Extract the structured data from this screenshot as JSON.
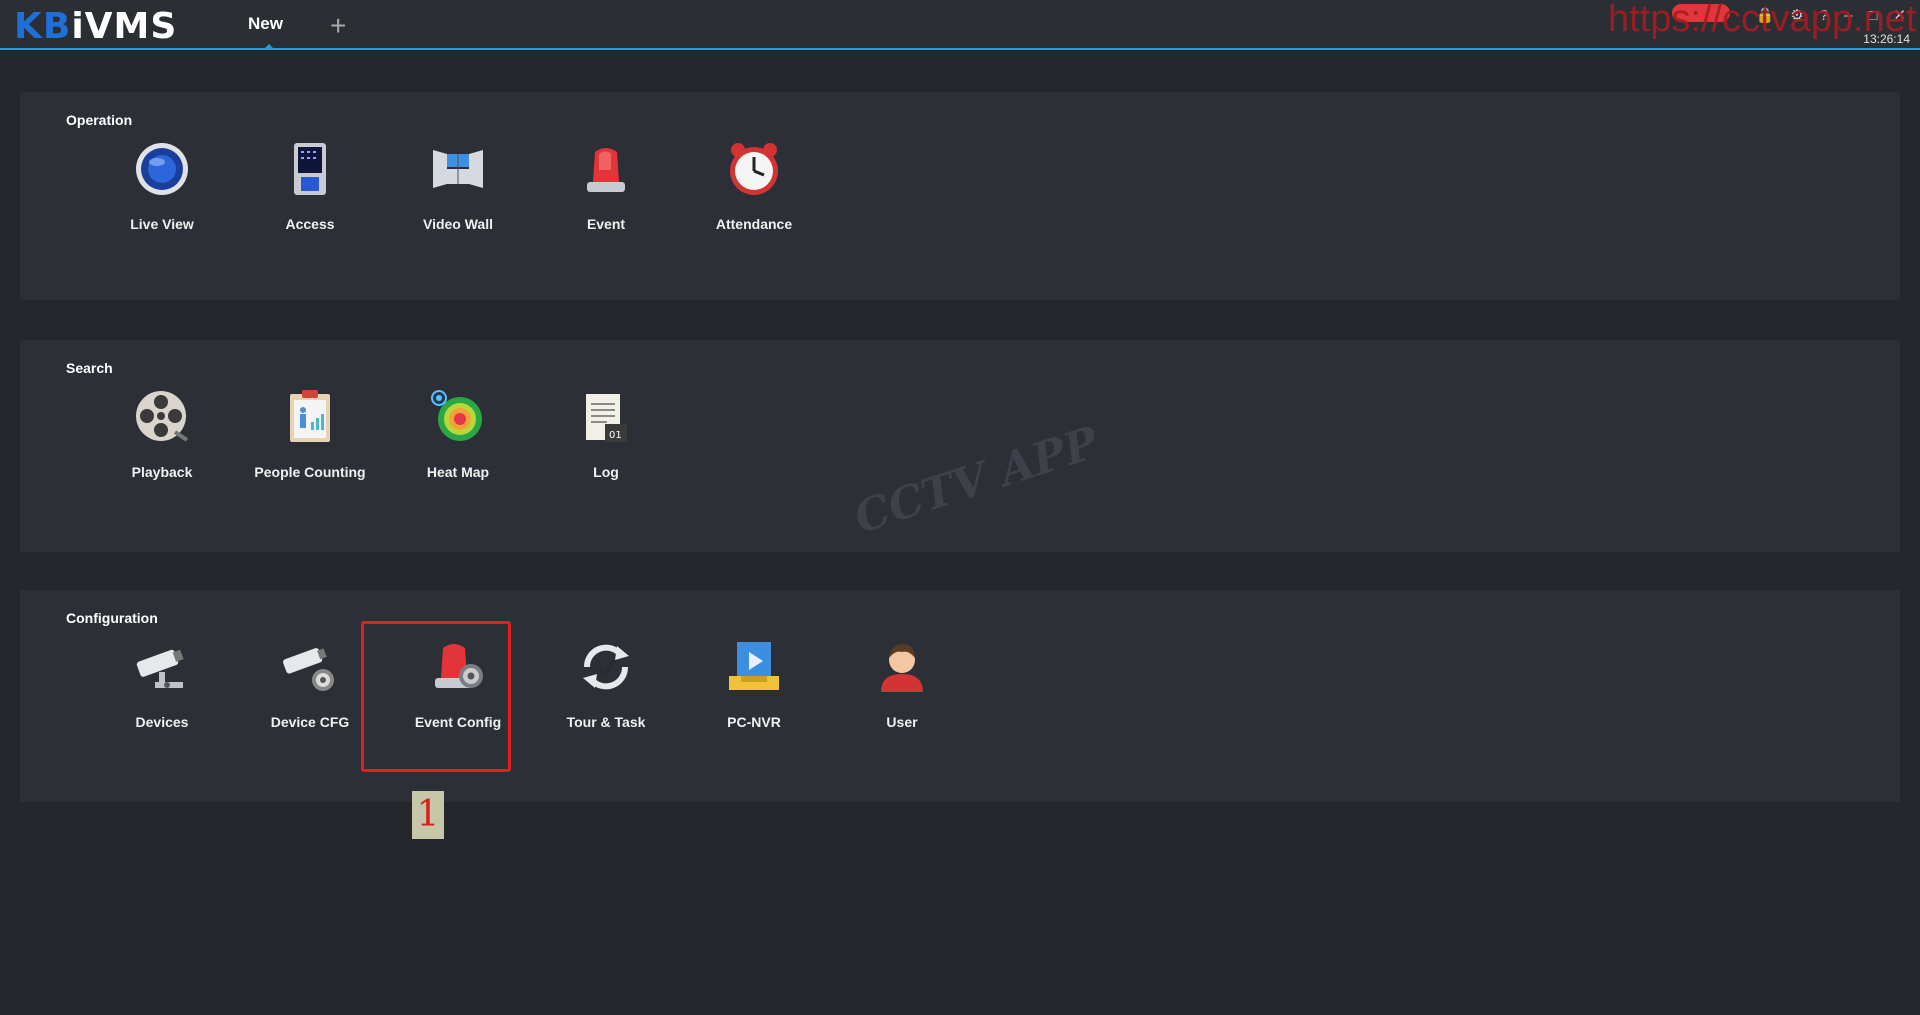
{
  "header": {
    "logo_prefix": "KB",
    "logo_suffix": "iVMS",
    "tab_new": "New",
    "add_tab": "+",
    "clock": "13:26:14",
    "watermark_url": "https://cctvapp.net",
    "watermark_center": "CCTV APP"
  },
  "sections": {
    "operation": {
      "title": "Operation",
      "items": [
        "Live View",
        "Access",
        "Video Wall",
        "Event",
        "Attendance"
      ]
    },
    "search": {
      "title": "Search",
      "items": [
        "Playback",
        "People Counting",
        "Heat Map",
        "Log"
      ]
    },
    "configuration": {
      "title": "Configuration",
      "items": [
        "Devices",
        "Device CFG",
        "Event Config",
        "Tour & Task",
        "PC-NVR",
        "User"
      ]
    }
  },
  "annotation": {
    "step": "1"
  },
  "colors": {
    "accent": "#1f9fd6",
    "highlight": "#e02020",
    "background": "#24272c",
    "panel": "#2c2f35"
  }
}
